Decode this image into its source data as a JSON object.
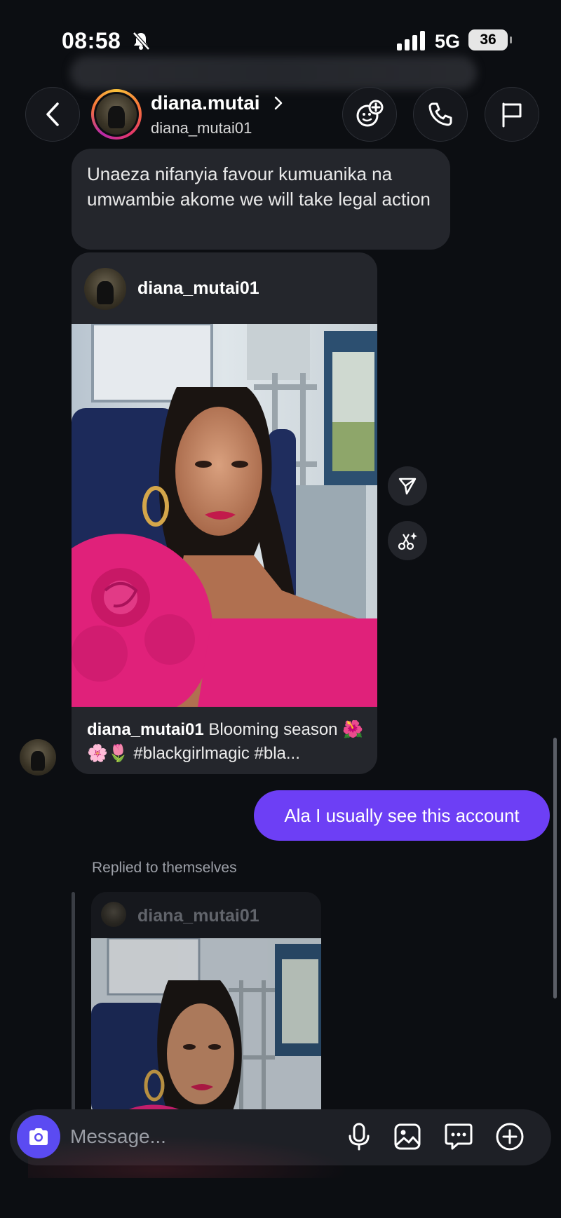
{
  "status_bar": {
    "time": "08:58",
    "network": "5G",
    "battery": "36"
  },
  "header": {
    "contact_name": "diana.mutai",
    "contact_handle": "diana_mutai01",
    "icons": [
      "back-icon",
      "effects-icon",
      "phone-icon",
      "flag-icon"
    ]
  },
  "thread": {
    "incoming_text": "Unaeza nifanyia favour kumuanika na umwambie akome we will take legal action",
    "shared_post": {
      "author": "diana_mutai01",
      "caption_author": "diana_mutai01",
      "caption_text": "Blooming season 🌺🌸🌷 #blackgirlmagic #bla..."
    },
    "outgoing_text": "Ala I usually see this account",
    "reply": {
      "label": "Replied to themselves",
      "author": "diana_mutai01"
    }
  },
  "composer": {
    "placeholder": "Message...",
    "icons": [
      "camera-icon",
      "microphone-icon",
      "gallery-icon",
      "sticker-icon",
      "add-icon"
    ]
  },
  "colors": {
    "background": "#0c0e12",
    "bubble_gray": "#24262c",
    "bubble_outgoing": "#6d3ff5",
    "camera_button": "#5b4bf2"
  }
}
